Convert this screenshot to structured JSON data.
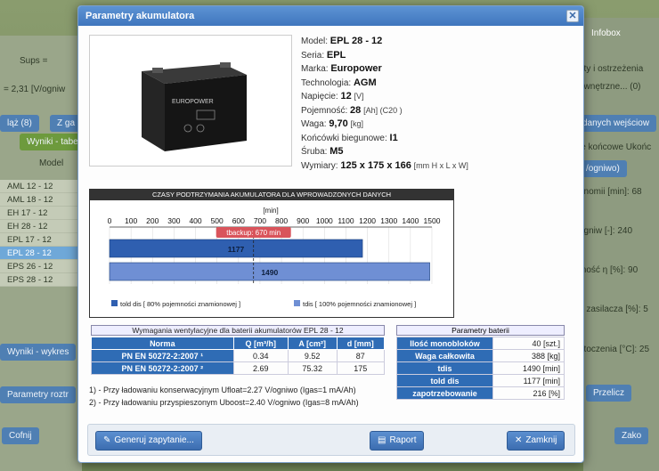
{
  "background": {
    "left": [
      "Sups =",
      "= 2,31 [V/ogniw",
      "ląż (8)",
      "Z ga",
      "Wyniki - tabela",
      "Model"
    ],
    "right": [
      "Infobox",
      "aty i ostrzeżenia",
      "ewnętrzne... (0)",
      "danych wejściow",
      "ie końcowe Ukońc",
      "/ogniwo)",
      "onomii [min]: 68",
      "ogniw [-]: 240",
      "mość η [%]: 90",
      "e zasilacza [%]: 5",
      "otoczenia [°C]: 25",
      "Przelicz",
      "Zako"
    ],
    "list": [
      "AML 12 - 12",
      "AML 18 - 12",
      "EH 17 - 12",
      "EH 28 - 12",
      "EPL 17 - 12",
      "EPL 28 - 12",
      "EPS 26 - 12",
      "EPS 28 - 12"
    ],
    "bottom_left": [
      "Wyniki - wykres",
      "Parametry roztr",
      "Cofnij"
    ]
  },
  "dialog": {
    "title": "Parametry akumulatora",
    "close": "✕"
  },
  "specs": [
    {
      "label": "Model:",
      "value": "EPL 28 - 12",
      "unit": ""
    },
    {
      "label": "Seria:",
      "value": "EPL",
      "unit": ""
    },
    {
      "label": "Marka:",
      "value": "Europower",
      "unit": ""
    },
    {
      "label": "Technologia:",
      "value": "AGM",
      "unit": ""
    },
    {
      "label": "Napięcie:",
      "value": "12",
      "unit": "[V]"
    },
    {
      "label": "Pojemność:",
      "value": "28",
      "unit": "[Ah] (C20 )"
    },
    {
      "label": "Waga:",
      "value": "9,70",
      "unit": "[kg]"
    },
    {
      "label": "Końcówki biegunowe:",
      "value": "I1",
      "unit": ""
    },
    {
      "label": "Śruba:",
      "value": "M5",
      "unit": ""
    },
    {
      "label": "Wymiary:",
      "value": "125 x 175 x 166",
      "unit": "[mm H x L x W]"
    }
  ],
  "battery_label": "EUROPOWER",
  "chart_data": {
    "type": "bar",
    "title": "CZASY PODTRZYMANIA AKUMULATORA DLA WPROWADZONYCH DANYCH",
    "xlabel": "[min]",
    "xlim": [
      0,
      1500
    ],
    "ticks": [
      0,
      100,
      200,
      300,
      400,
      500,
      600,
      700,
      800,
      900,
      1000,
      1100,
      1200,
      1300,
      1400,
      1500
    ],
    "series": [
      {
        "name": "told dis [ 80% pojemności znamionowej ]",
        "value": 1177,
        "color": "#2f5fb0"
      },
      {
        "name": "tdis [ 100% pojemności znamionowej ]",
        "value": 1490,
        "color": "#6f8fd4"
      }
    ],
    "marker": {
      "label": "tbackup: 670 min",
      "value": 670
    }
  },
  "requirements": {
    "title": "Wymagania wentylacyjne dla baterii akumulatorów EPL 28 - 12",
    "headers": [
      "Norma",
      "Q [m³/h]",
      "A [cm²]",
      "d [mm]"
    ],
    "rows": [
      [
        "PN EN 50272-2:2007 ¹",
        "0.34",
        "9.52",
        "87"
      ],
      [
        "PN EN 50272-2:2007 ²",
        "2.69",
        "75.32",
        "175"
      ]
    ],
    "notes": [
      "1) - Przy ładowaniu konserwacyjnym Ufloat=2.27 V/ogniwo (Igas=1 mA/Ah)",
      "2) - Przy ładowaniu przyspieszonym Uboost=2.40 V/ogniwo (Igas=8 mA/Ah)"
    ]
  },
  "params": {
    "title": "Parametry baterii",
    "rows": [
      {
        "k": "Ilość monobloków",
        "v": "40 [szt.]"
      },
      {
        "k": "Waga całkowita",
        "v": "388 [kg]"
      },
      {
        "k": "tdis",
        "v": "1490 [min]"
      },
      {
        "k": "told dis",
        "v": "1177 [min]"
      },
      {
        "k": "zapotrzebowanie",
        "v": "216 [%]"
      }
    ]
  },
  "buttons": {
    "generate": "Generuj zapytanie...",
    "report": "Raport",
    "close": "Zamknij"
  }
}
